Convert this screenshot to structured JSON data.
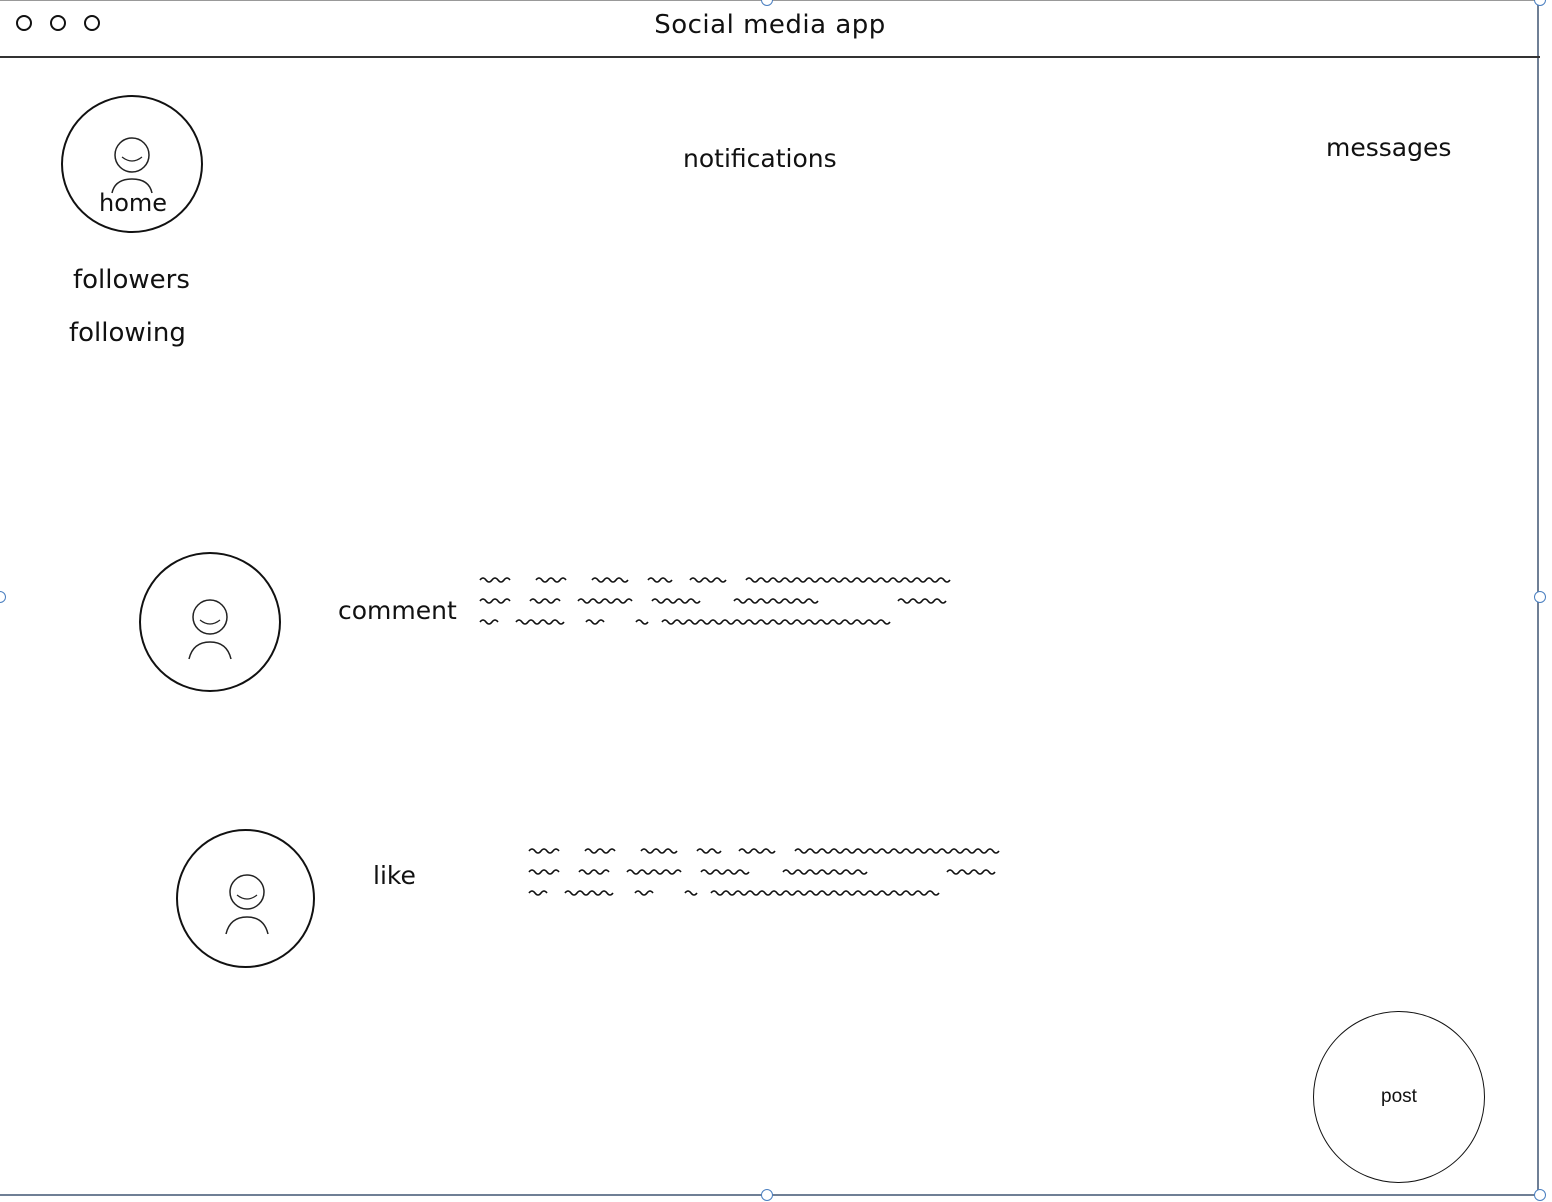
{
  "window": {
    "title": "Social media app"
  },
  "nav": {
    "home_label": "home",
    "notifications_label": "notifications",
    "messages_label": "messages",
    "followers_label": "followers",
    "following_label": "following"
  },
  "feed": {
    "items": [
      {
        "action_label": "comment"
      },
      {
        "action_label": "like"
      }
    ]
  },
  "post_button": {
    "label": "post"
  },
  "icons": {
    "window_controls": [
      "window-dot-icon",
      "window-dot-icon",
      "window-dot-icon"
    ],
    "avatar": "user-icon"
  }
}
